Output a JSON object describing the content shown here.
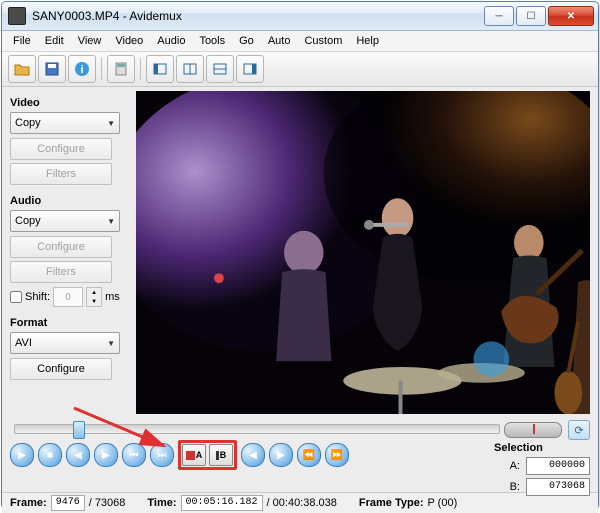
{
  "window": {
    "title": "SANY0003.MP4 - Avidemux"
  },
  "menu": {
    "items": [
      "File",
      "Edit",
      "View",
      "Video",
      "Audio",
      "Tools",
      "Go",
      "Auto",
      "Custom",
      "Help"
    ]
  },
  "sidebar": {
    "video": {
      "label": "Video",
      "select": "Copy",
      "configure": "Configure",
      "filters": "Filters"
    },
    "audio": {
      "label": "Audio",
      "select": "Copy",
      "configure": "Configure",
      "filters": "Filters"
    },
    "shift": {
      "label": "Shift:",
      "value": "0",
      "unit": "ms"
    },
    "format": {
      "label": "Format",
      "select": "AVI",
      "configure": "Configure"
    }
  },
  "selection": {
    "label": "Selection",
    "a_label": "A:",
    "a_value": "000000",
    "b_label": "B:",
    "b_value": "073068"
  },
  "status": {
    "frame_label": "Frame:",
    "frame_value": "9476",
    "frame_total": "/ 73068",
    "time_label": "Time:",
    "time_value": "00:05:16.182",
    "time_total": "/ 00:40:38.038",
    "ftype_label": "Frame Type:",
    "ftype_value": "P (00)"
  },
  "marker": {
    "a": "A",
    "b": "B"
  }
}
